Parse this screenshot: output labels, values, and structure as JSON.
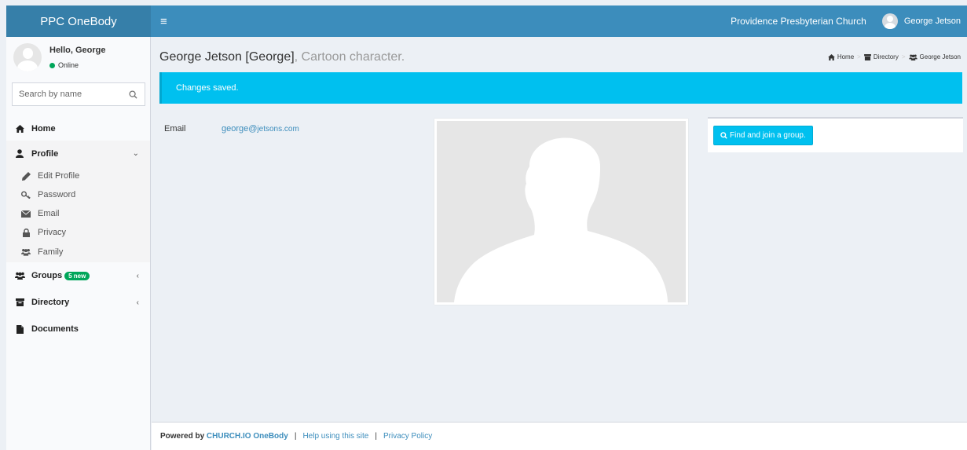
{
  "header": {
    "brand": "PPC OneBody",
    "church_name": "Providence Presbyterian Church",
    "user_name": "George Jetson",
    "menu_icon": "hamburger-icon",
    "accent_color": "#3c8dbc"
  },
  "sidebar": {
    "greeting": "Hello, George",
    "status": "Online",
    "search": {
      "placeholder": "Search by name"
    },
    "menu": {
      "home": "Home",
      "profile": "Profile",
      "profile_sub": {
        "edit_profile": "Edit Profile",
        "password": "Password",
        "email": "Email",
        "privacy": "Privacy",
        "family": "Family"
      },
      "groups": "Groups",
      "groups_badge": "5 new",
      "directory": "Directory",
      "documents": "Documents"
    }
  },
  "main": {
    "title": "George Jetson [George]",
    "subtitle": ", Cartoon character.",
    "breadcrumb": {
      "home": "Home",
      "directory": "Directory",
      "person": "George Jetson"
    },
    "alert": "Changes saved.",
    "email_label": "Email",
    "email_user": "george@",
    "email_domain": "jetsons.com",
    "find_group_button": "Find and join a group."
  },
  "footer": {
    "powered_by": "Powered by",
    "product": "CHURCH.IO OneBody",
    "help_link": "Help using this site",
    "privacy_link": "Privacy Policy",
    "separator": "|"
  }
}
